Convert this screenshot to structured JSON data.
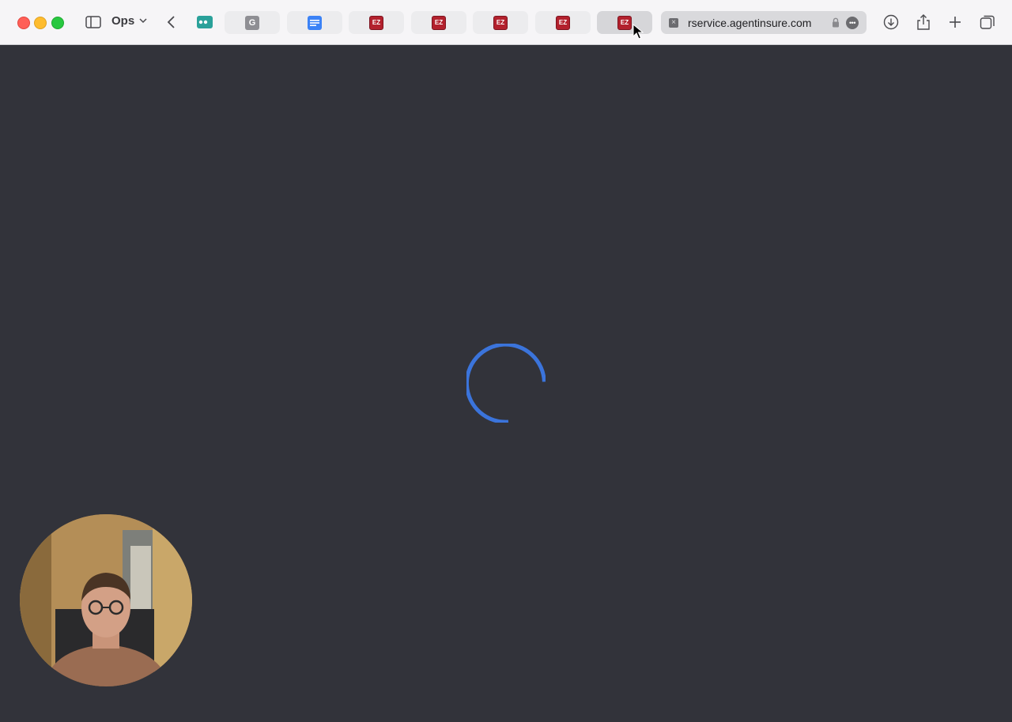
{
  "window": {
    "tab_group_label": "Ops",
    "url_text": "rservice.agentinsure.com"
  },
  "tabs": [
    {
      "name": "tab-bot",
      "icon": "bot-icon",
      "fav_text": ""
    },
    {
      "name": "tab-g",
      "icon": "g-icon",
      "fav_text": "G"
    },
    {
      "name": "tab-docs",
      "icon": "docs-icon",
      "fav_text": ""
    },
    {
      "name": "tab-ez-1",
      "icon": "ez-icon",
      "fav_text": "EZ"
    },
    {
      "name": "tab-ez-2",
      "icon": "ez-icon",
      "fav_text": "EZ"
    },
    {
      "name": "tab-ez-3",
      "icon": "ez-icon",
      "fav_text": "EZ"
    },
    {
      "name": "tab-ez-4",
      "icon": "ez-icon",
      "fav_text": "EZ"
    },
    {
      "name": "tab-ez-5",
      "icon": "ez-icon",
      "fav_text": "EZ"
    }
  ],
  "colors": {
    "page_background": "#32333a",
    "spinner": "#3b74db",
    "toolbar": "#f6f5f7"
  }
}
